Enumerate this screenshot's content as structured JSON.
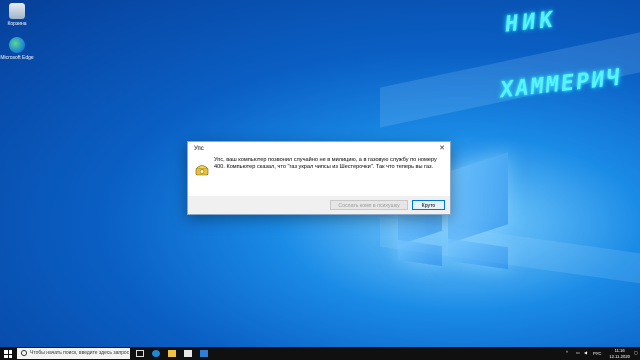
{
  "desktop": {
    "icons": [
      {
        "label": "Корзина",
        "icon": "recycle-bin-icon"
      },
      {
        "label": "Microsoft Edge",
        "icon": "edge-icon"
      }
    ],
    "watermark": {
      "line1": "НИК",
      "line2": "ХАММЕРИЧ",
      "color": "#5ef0ff"
    }
  },
  "dialog": {
    "title": "Упс",
    "close_glyph": "✕",
    "icon": "phone-warning-icon",
    "message": "Упс, ваш компьютер позвонил случайно не в милицию, а в газовую службу по номеру 400. Компьютер сказал, что \"газ украл чипсы из Шестерочки\". Так что теперь вы газ.",
    "buttons": {
      "secondary": {
        "label": "Сослать комп в психушку",
        "enabled": false
      },
      "primary": {
        "label": "Круто",
        "enabled": true
      }
    }
  },
  "taskbar": {
    "search_placeholder": "Чтобы начать поиск, введите здесь запрос",
    "pinned": [
      "task-view-icon",
      "edge-icon",
      "file-explorer-icon",
      "store-icon",
      "mail-icon"
    ],
    "tray_lang": "РУС",
    "time": "11:16",
    "date": "12.11.2020"
  },
  "colors": {
    "accent": "#0078d7",
    "taskbar": "#101010"
  }
}
